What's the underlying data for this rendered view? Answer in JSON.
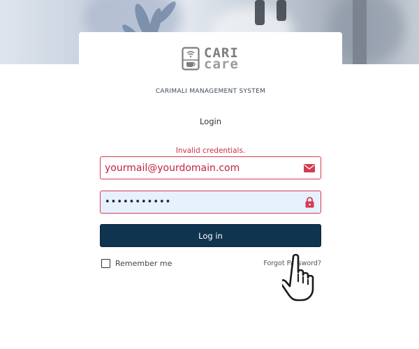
{
  "brand": {
    "logo_line1": "CARI",
    "logo_line2": "care",
    "system_title": "CARIMALI MANAGEMENT SYSTEM"
  },
  "form": {
    "title": "Login",
    "error": "Invalid credentials.",
    "email_value": "yourmail@yourdomain.com",
    "password_value": "•••••••••••",
    "submit_label": "Log in",
    "remember_label": "Remember me",
    "remember_checked": false,
    "forgot_label": "Forgot Password?"
  },
  "icons": {
    "email": "envelope-icon",
    "password": "lock-icon",
    "cursor": "hand-pointer-icon"
  },
  "colors": {
    "primary": "#0f3450",
    "error": "#cc2f47",
    "field_border": "#d63a52",
    "autofill_bg": "#e7f0fd"
  }
}
